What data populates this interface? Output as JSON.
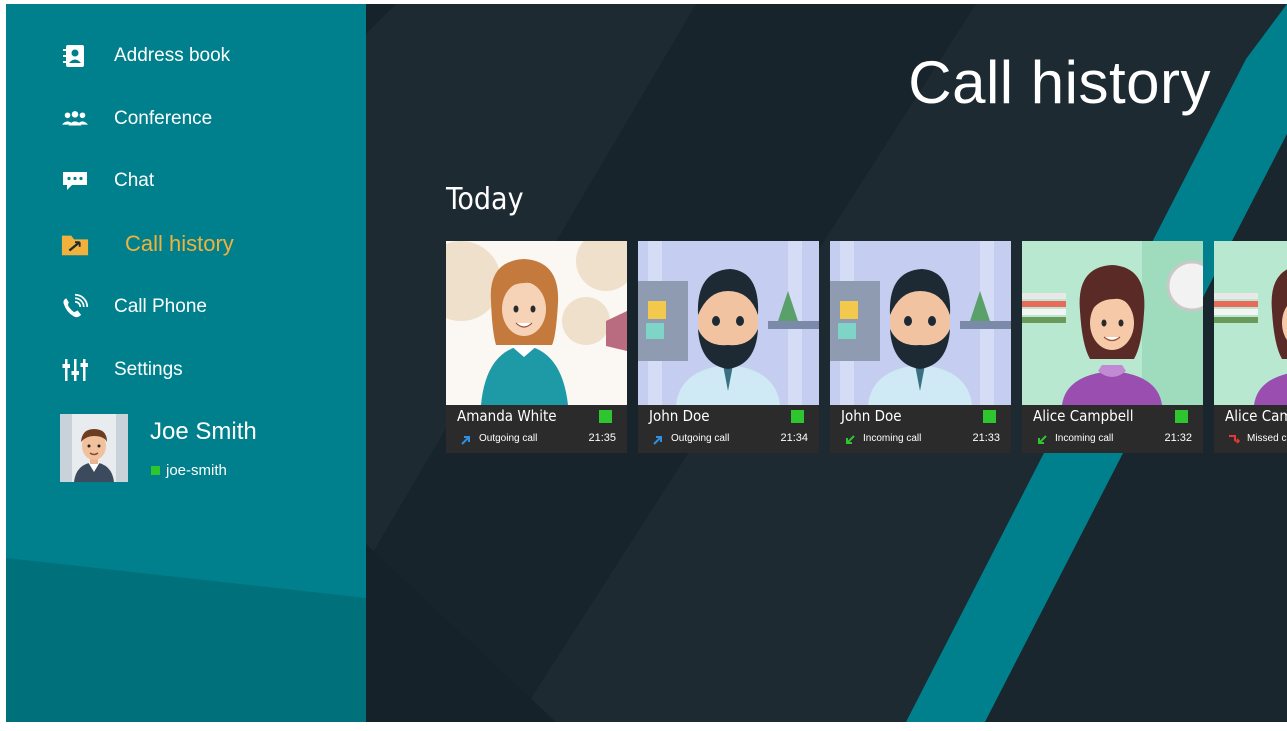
{
  "sidebar": {
    "items": [
      {
        "label": "Address book",
        "icon": "address-book-icon"
      },
      {
        "label": "Conference",
        "icon": "conference-icon"
      },
      {
        "label": "Chat",
        "icon": "chat-icon"
      },
      {
        "label": "Call history",
        "icon": "call-history-icon",
        "active": true
      },
      {
        "label": "Call Phone",
        "icon": "call-phone-icon"
      },
      {
        "label": "Settings",
        "icon": "settings-icon"
      }
    ],
    "profile": {
      "name": "Joe Smith",
      "handle": "joe-smith",
      "status_color": "#2fc52f"
    }
  },
  "main": {
    "title": "Call history",
    "section": "Today",
    "cards": [
      {
        "name": "Amanda White",
        "direction": "Outgoing call",
        "direction_icon": "outgoing-call-icon",
        "time": "21:35"
      },
      {
        "name": "John Doe",
        "direction": "Outgoing call",
        "direction_icon": "outgoing-call-icon",
        "time": "21:34"
      },
      {
        "name": "John Doe",
        "direction": "Incoming call",
        "direction_icon": "incoming-call-icon",
        "time": "21:33"
      },
      {
        "name": "Alice Campbell",
        "direction": "Incoming call",
        "direction_icon": "incoming-call-icon",
        "time": "21:32"
      },
      {
        "name": "Alice Campbell",
        "direction": "Missed call",
        "direction_icon": "missed-call-icon",
        "time": ""
      }
    ]
  },
  "colors": {
    "sidebar": "#00808c",
    "main_bg": "#1d2a32",
    "accent": "#f2b13c",
    "online": "#2fc52f",
    "outgoing": "#2f8fe0",
    "incoming": "#2fc52f",
    "missed": "#e53935"
  }
}
